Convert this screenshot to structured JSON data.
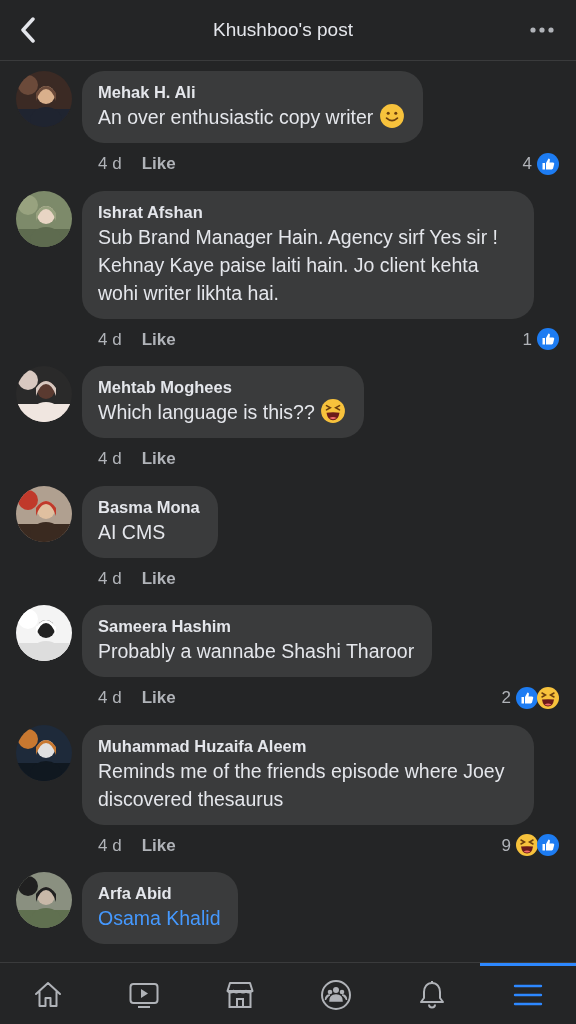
{
  "header": {
    "title": "Khushboo's post"
  },
  "comments": [
    {
      "name": "Mehak H. Ali",
      "text": "An over enthusiastic copy writer",
      "emoji": {
        "kind": "smile"
      },
      "mention": false,
      "time": "4 d",
      "like": "Like",
      "reaction_count": "4",
      "reactions": [
        {
          "kind": "like"
        }
      ]
    },
    {
      "name": "Ishrat Afshan",
      "text": "Sub Brand Manager Hain. Agency sirf Yes sir ! Kehnay Kaye paise laiti hain. Jo client kehta wohi writer likhta hai.",
      "mention": false,
      "time": "4 d",
      "like": "Like",
      "reaction_count": "1",
      "reactions": [
        {
          "kind": "like"
        }
      ]
    },
    {
      "name": "Mehtab Moghees",
      "text": "Which language is this??",
      "emoji": {
        "kind": "laugh"
      },
      "mention": false,
      "time": "4 d",
      "like": "Like"
    },
    {
      "name": "Basma Mona",
      "text": "AI CMS",
      "mention": false,
      "time": "4 d",
      "like": "Like"
    },
    {
      "name": "Sameera Hashim",
      "text": "Probably a wannabe Shashi Tharoor",
      "mention": false,
      "time": "4 d",
      "like": "Like",
      "reaction_count": "2",
      "reactions": [
        {
          "kind": "like"
        },
        {
          "kind": "haha"
        }
      ]
    },
    {
      "name": "Muhammad Huzaifa Aleem",
      "text": "Reminds me of the friends episode where Joey discovered thesaurus",
      "mention": false,
      "time": "4 d",
      "like": "Like",
      "reaction_count": "9",
      "reactions": [
        {
          "kind": "haha"
        },
        {
          "kind": "like"
        }
      ]
    },
    {
      "name": "Arfa Abid",
      "text": "Osama Khalid",
      "mention": true
    }
  ],
  "tabs": [
    {
      "kind": "home",
      "selected": false
    },
    {
      "kind": "video",
      "selected": false
    },
    {
      "kind": "marketplace",
      "selected": false
    },
    {
      "kind": "groups",
      "selected": false
    },
    {
      "kind": "notifications",
      "selected": false
    },
    {
      "kind": "menu",
      "selected": true
    }
  ]
}
